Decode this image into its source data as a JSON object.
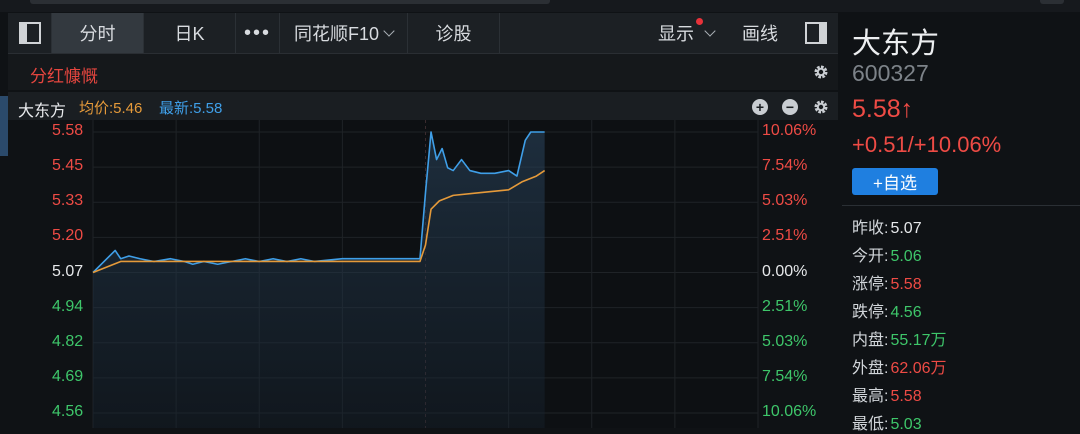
{
  "toolbar": {
    "tabs": [
      "分时",
      "日K",
      "•••",
      "同花顺F10",
      "诊股"
    ],
    "display_label": "显示",
    "draw_label": "画线"
  },
  "subbar": {
    "dividend_label": "分红慷慨"
  },
  "legend": {
    "stock_name": "大东方",
    "avg_label": "均价:5.46",
    "latest_label": "最新:5.58"
  },
  "chart_data": {
    "type": "line",
    "y_price_ticks": [
      "5.58",
      "5.45",
      "5.33",
      "5.20",
      "5.07",
      "4.94",
      "4.82",
      "4.69",
      "4.56"
    ],
    "y_pct_ticks": [
      "10.06%",
      "7.54%",
      "5.03%",
      "2.51%",
      "0.00%",
      "2.51%",
      "5.03%",
      "7.54%",
      "10.06%"
    ],
    "ylim": [
      4.56,
      5.58
    ],
    "prev_close": 5.07,
    "x_minutes_total": 240,
    "series": [
      {
        "name": "最新",
        "color": "#3f9fe8",
        "x": [
          0,
          3,
          6,
          8,
          10,
          13,
          17,
          22,
          28,
          33,
          36,
          40,
          45,
          50,
          55,
          60,
          65,
          70,
          75,
          80,
          90,
          100,
          110,
          118,
          120,
          122,
          124,
          126,
          128,
          130,
          133,
          136,
          140,
          145,
          150,
          153,
          156,
          158,
          160,
          165,
          170,
          175,
          180,
          185,
          190,
          195,
          200,
          205,
          210,
          215,
          220,
          225,
          230,
          235,
          240
        ],
        "values": [
          5.07,
          5.1,
          5.13,
          5.15,
          5.12,
          5.13,
          5.12,
          5.11,
          5.12,
          5.11,
          5.1,
          5.11,
          5.1,
          5.11,
          5.12,
          5.11,
          5.12,
          5.11,
          5.12,
          5.11,
          5.12,
          5.12,
          5.12,
          5.12,
          5.36,
          5.58,
          5.48,
          5.52,
          5.45,
          5.44,
          5.48,
          5.44,
          5.43,
          5.43,
          5.44,
          5.42,
          5.55,
          5.58,
          5.58,
          5.58,
          5.58,
          5.58,
          5.58,
          5.58,
          5.58,
          5.58,
          5.58,
          5.58,
          5.58,
          5.58,
          5.58,
          5.58,
          5.58,
          5.58,
          5.58
        ]
      },
      {
        "name": "均价",
        "color": "#e59a3a",
        "x": [
          0,
          5,
          10,
          20,
          40,
          60,
          80,
          100,
          118,
          120,
          122,
          125,
          130,
          140,
          150,
          155,
          160,
          170,
          180,
          200,
          220,
          240
        ],
        "values": [
          5.07,
          5.09,
          5.11,
          5.11,
          5.11,
          5.11,
          5.11,
          5.11,
          5.11,
          5.17,
          5.3,
          5.33,
          5.35,
          5.36,
          5.37,
          5.4,
          5.42,
          5.44,
          5.45,
          5.46,
          5.46,
          5.46
        ]
      }
    ],
    "x_shown_end": 163
  },
  "quote": {
    "name": "大东方",
    "code": "600327",
    "price": "5.58↑",
    "change": "+0.51/+10.06%",
    "add_label": "+自选",
    "rows": [
      {
        "k": "昨收:",
        "v": "5.07",
        "color": "#e6e8ea"
      },
      {
        "k": "今开:",
        "v": "5.06",
        "color": "#3ec66a"
      },
      {
        "k": "涨停:",
        "v": "5.58",
        "color": "#ee4b45"
      },
      {
        "k": "跌停:",
        "v": "4.56",
        "color": "#3ec66a"
      },
      {
        "k": "内盘:",
        "v": "55.17万",
        "color": "#3ec66a"
      },
      {
        "k": "外盘:",
        "v": "62.06万",
        "color": "#ee4b45"
      },
      {
        "k": "最高:",
        "v": "5.58",
        "color": "#ee4b45"
      },
      {
        "k": "最低:",
        "v": "5.03",
        "color": "#3ec66a"
      }
    ]
  },
  "colors": {
    "up": "#ee4b45",
    "down": "#3ec66a",
    "flat": "#e6e8ea",
    "accent": "#1f7fe0"
  }
}
